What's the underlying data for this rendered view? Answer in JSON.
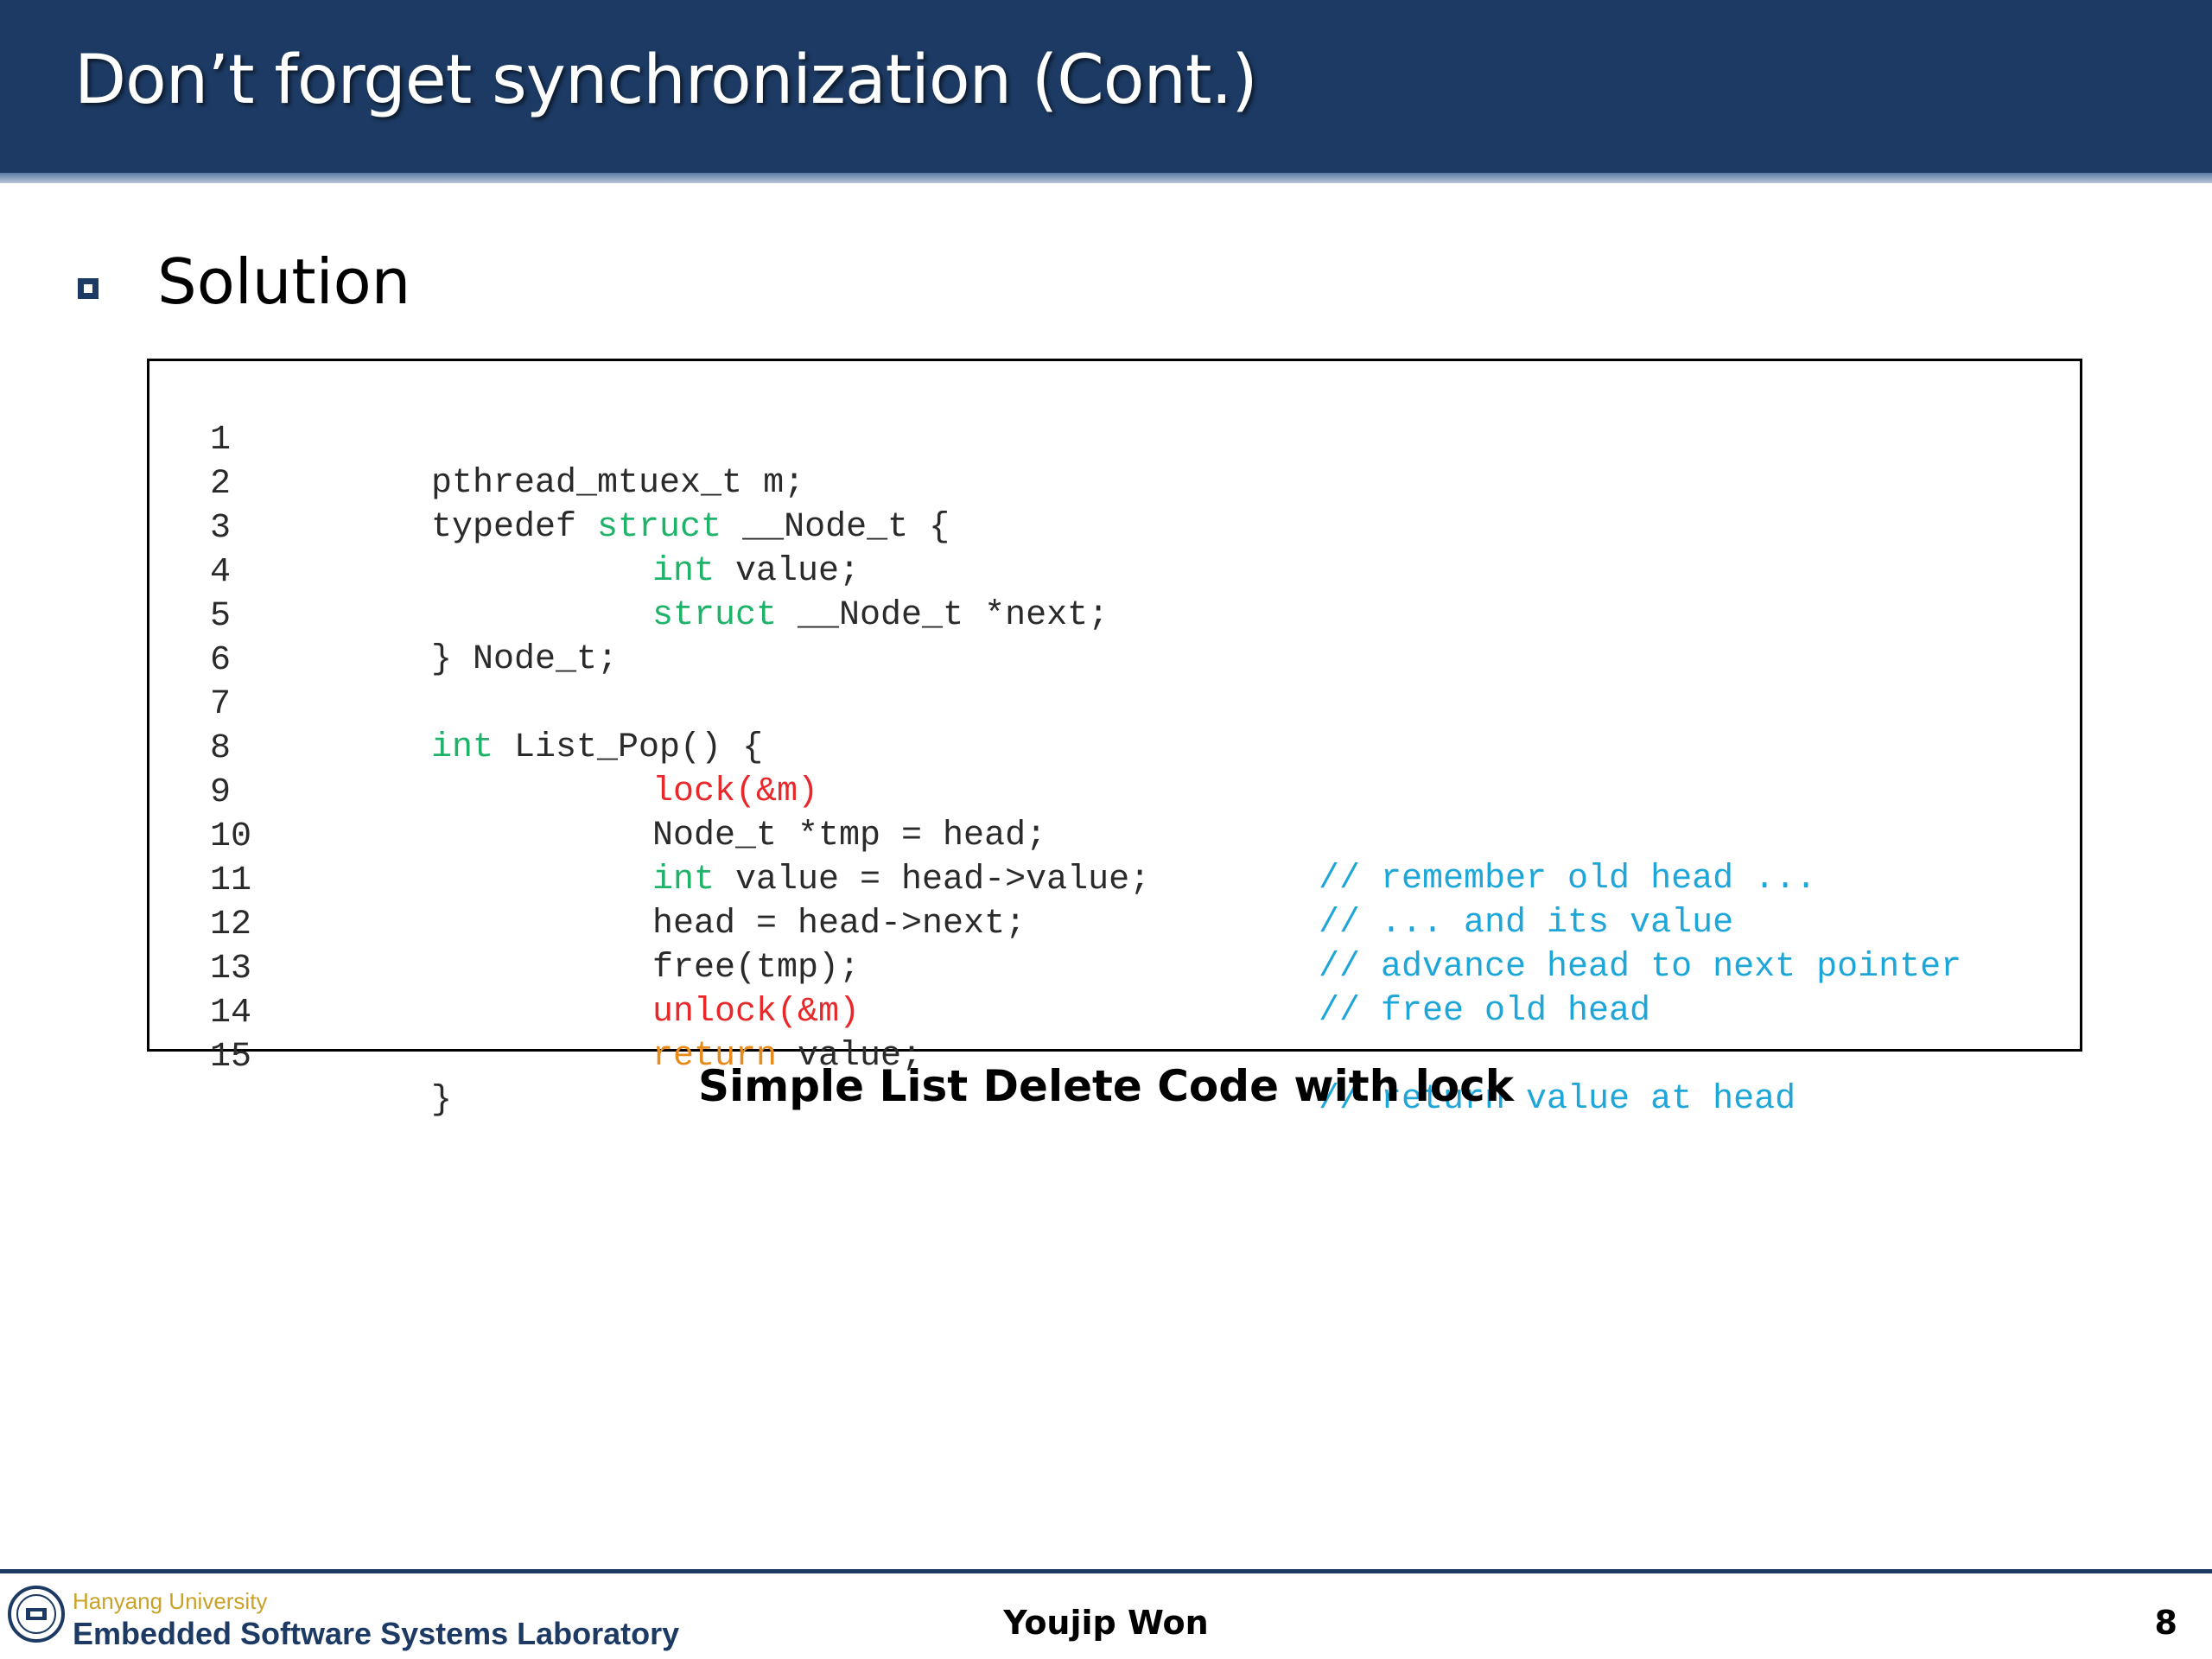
{
  "slide": {
    "title": "Don’t forget synchronization (Cont.)",
    "bullet": "Solution",
    "caption": "Simple List Delete Code with lock"
  },
  "colors": {
    "title_bar": "#1c3a63",
    "keyword_green": "#1fb36a",
    "keyword_red": "#e8282b",
    "keyword_orange": "#e88a1c",
    "comment_blue": "#1ea6d8"
  },
  "code": {
    "lines": [
      {
        "num": "1",
        "parts": [
          "pthread_mtuex_t m;"
        ]
      },
      {
        "num": "2",
        "parts": [
          "typedef ",
          "struct",
          " __Node_t {"
        ]
      },
      {
        "num": "3",
        "parts": [
          "int",
          " value;"
        ]
      },
      {
        "num": "4",
        "parts": [
          "struct",
          " __Node_t *next;"
        ]
      },
      {
        "num": "5",
        "parts": [
          "} Node_t;"
        ]
      },
      {
        "num": "6",
        "parts": []
      },
      {
        "num": "7",
        "parts": [
          "int",
          " List_Pop() {"
        ]
      },
      {
        "num": "8",
        "parts": [
          "lock(&m)"
        ]
      },
      {
        "num": "9",
        "parts": [
          "Node_t *tmp = head;"
        ],
        "comment": "// remember old head ..."
      },
      {
        "num": "10",
        "parts": [
          "int",
          " value = head->value;"
        ],
        "comment": "// ... and its value"
      },
      {
        "num": "11",
        "parts": [
          "head = head->next;"
        ],
        "comment": "// advance head to next pointer"
      },
      {
        "num": "12",
        "parts": [
          "free(tmp);"
        ],
        "comment": "// free old head"
      },
      {
        "num": "13",
        "parts": [
          "unlock(&m)"
        ]
      },
      {
        "num": "14",
        "parts": [
          "return",
          " value;"
        ],
        "comment": "// return value at head"
      },
      {
        "num": "15",
        "parts": [
          "}"
        ]
      }
    ]
  },
  "footer": {
    "university": "Hanyang University",
    "lab": "Embedded Software Systems Laboratory",
    "author": "Youjip Won",
    "page": "8",
    "logo_icon": "university-seal-icon"
  }
}
